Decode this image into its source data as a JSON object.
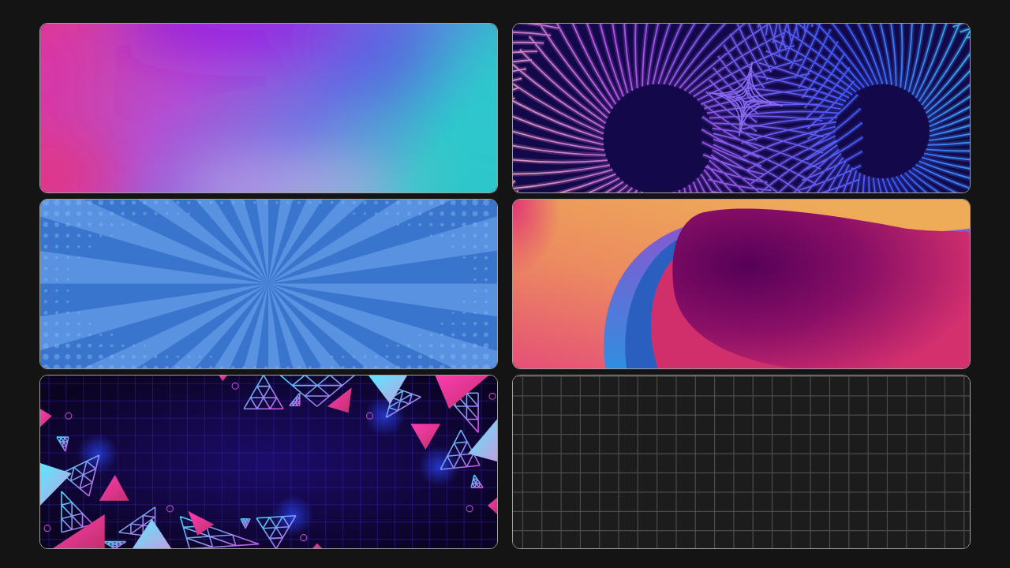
{
  "tiles": [
    {
      "kind": "gradient"
    },
    {
      "kind": "wireframe"
    },
    {
      "kind": "sunburst"
    },
    {
      "kind": "waves"
    },
    {
      "kind": "triangles"
    },
    {
      "kind": "grid"
    }
  ]
}
